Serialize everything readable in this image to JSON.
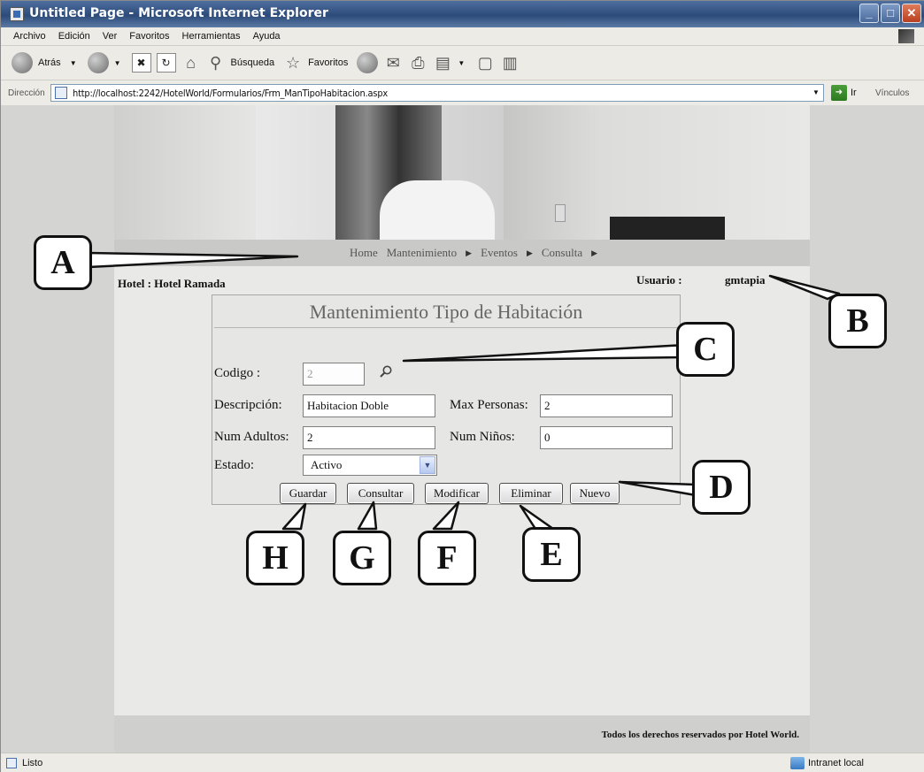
{
  "window": {
    "title": "Untitled Page - Microsoft Internet Explorer",
    "controls": [
      "_",
      "□",
      "✕"
    ]
  },
  "menubar": {
    "items": [
      "Archivo",
      "Edición",
      "Ver",
      "Favoritos",
      "Herramientas",
      "Ayuda"
    ]
  },
  "toolbar": {
    "back_label": "Atrás",
    "search_label": "Búsqueda",
    "favorites_label": "Favoritos"
  },
  "addressbar": {
    "label": "Dirección",
    "url": "http://localhost:2242/HotelWorld/Formularios/Frm_ManTipoHabitacion.aspx",
    "go_label": "Ir",
    "links_label": "Vínculos"
  },
  "nav": {
    "items": [
      "Home",
      "Mantenimiento",
      "Eventos",
      "Consulta"
    ]
  },
  "header": {
    "hotel_label": "Hotel :",
    "hotel_value": "Hotel Ramada",
    "user_label": "Usuario :",
    "user_value": "gmtapia"
  },
  "form": {
    "title": "Mantenimiento Tipo de Habitación",
    "codigo_label": "Codigo :",
    "codigo_value": "2",
    "descripcion_label": "Descripción:",
    "descripcion_value": "Habitacion Doble",
    "max_personas_label": "Max Personas:",
    "max_personas_value": "2",
    "num_adultos_label": "Num Adultos:",
    "num_adultos_value": "2",
    "num_ninos_label": "Num Niños:",
    "num_ninos_value": "0",
    "estado_label": "Estado:",
    "estado_value": "Activo",
    "buttons": {
      "guardar": "Guardar",
      "consultar": "Consultar",
      "modificar": "Modificar",
      "eliminar": "Eliminar",
      "nuevo": "Nuevo"
    }
  },
  "footer": {
    "text": "Todos los derechos reservados por Hotel World."
  },
  "status": {
    "text": "Listo",
    "zone": "Intranet local"
  },
  "callouts": {
    "a": "A",
    "b": "B",
    "c": "C",
    "d": "D",
    "e": "E",
    "f": "F",
    "g": "G",
    "h": "H"
  },
  "colors": {
    "titlebar": "#2c4b7a",
    "chrome": "#ecebe6",
    "page_bg": "#e9e9e7"
  }
}
